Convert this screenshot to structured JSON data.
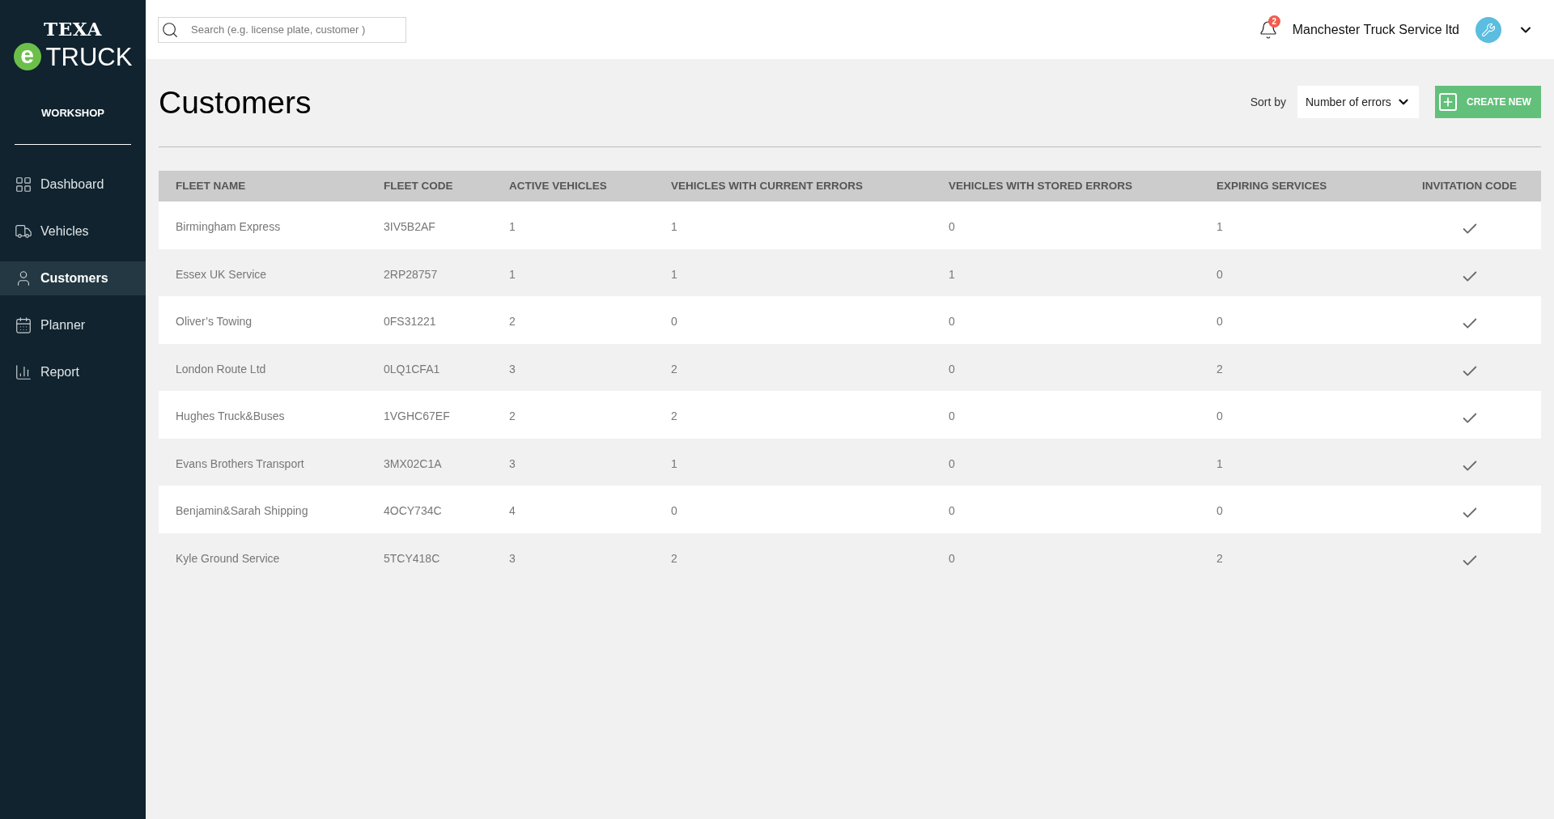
{
  "brand": {
    "top": "TEXA",
    "mark": "e",
    "name": "TRUCK"
  },
  "sidebar": {
    "section": "WORKSHOP",
    "items": [
      {
        "label": "Dashboard",
        "selected": false
      },
      {
        "label": "Vehicles",
        "selected": false
      },
      {
        "label": "Customers",
        "selected": true
      },
      {
        "label": "Planner",
        "selected": false
      },
      {
        "label": "Report",
        "selected": false
      }
    ]
  },
  "header": {
    "search": {
      "placeholder": "Search (e.g. license plate, customer )"
    },
    "notifications": "2",
    "account": "Manchester Truck Service ltd"
  },
  "page": {
    "title": "Customers",
    "sort_label": "Sort by",
    "sort_value": "Number of errors",
    "create_button": "CREATE NEW"
  },
  "table": {
    "columns": [
      "FLEET NAME",
      "FLEET CODE",
      "ACTIVE VEHICLES",
      "VEHICLES WITH CURRENT ERRORS",
      "VEHICLES WITH STORED ERRORS",
      "EXPIRING SERVICES",
      "INVITATION CODE"
    ],
    "rows": [
      {
        "cells": [
          "Birmingham Express",
          "3IV5B2AF",
          "1",
          "1",
          "0",
          "1"
        ],
        "invited": true
      },
      {
        "cells": [
          "Essex UK Service",
          "2RP28757",
          "1",
          "1",
          "1",
          "0"
        ],
        "invited": true
      },
      {
        "cells": [
          "Oliver’s Towing",
          "0FS31221",
          "2",
          "0",
          "0",
          "0"
        ],
        "invited": true
      },
      {
        "cells": [
          "London Route Ltd",
          "0LQ1CFA1",
          "3",
          "2",
          "0",
          "2"
        ],
        "invited": true
      },
      {
        "cells": [
          "Hughes Truck&Buses",
          "1VGHC67EF",
          "2",
          "2",
          "0",
          "0"
        ],
        "invited": true
      },
      {
        "cells": [
          "Evans Brothers Transport",
          "3MX02C1A",
          "3",
          "1",
          "0",
          "1"
        ],
        "invited": true
      },
      {
        "cells": [
          "Benjamin&Sarah Shipping",
          "4OCY734C",
          "4",
          "0",
          "0",
          "0"
        ],
        "invited": true
      },
      {
        "cells": [
          "Kyle Ground Service",
          "5TCY418C",
          "3",
          "2",
          "0",
          "2"
        ],
        "invited": true
      }
    ]
  }
}
